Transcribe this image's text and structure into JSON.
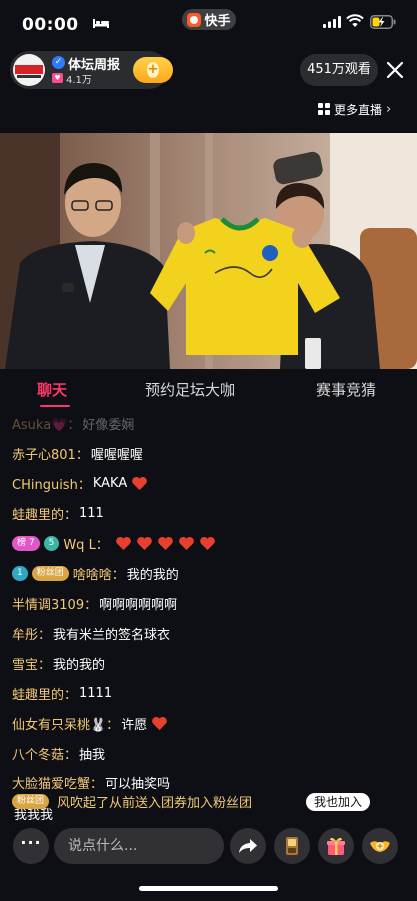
{
  "status_bar": {
    "time": "00:00",
    "app_name": "快手"
  },
  "streamer": {
    "name": "体坛周报",
    "likes": "4.1万"
  },
  "viewers": "451万观看",
  "more_live": "更多直播",
  "tabs": [
    "聊天",
    "预约足坛大咖",
    "赛事竞猜"
  ],
  "chat": [
    {
      "user": "Asuka💗：",
      "text": "好像委娴"
    },
    {
      "user": "赤子心801：",
      "text": "喔喔喔喔"
    },
    {
      "user": "CHinguish：",
      "text": "KAKA",
      "heart": 1
    },
    {
      "user": "蛙趣里的：",
      "text": "111"
    },
    {
      "badges": [
        {
          "text": "榜 7",
          "color": "pink"
        },
        {
          "text": "5",
          "color": "teal"
        }
      ],
      "user": "Wq L：",
      "text": "",
      "heart": 5
    },
    {
      "badges": [
        {
          "text": "1",
          "color": "cyan"
        },
        {
          "text": "粉丝团",
          "color": "gold"
        }
      ],
      "user": "啥啥啥：",
      "text": "我的我的"
    },
    {
      "user": "半情调3109：",
      "text": "啊啊啊啊啊啊"
    },
    {
      "user": "牟彤：",
      "text": "我有米兰的签名球衣"
    },
    {
      "user": "雪宝：",
      "text": "我的我的"
    },
    {
      "user": "蛙趣里的：",
      "text": "1111"
    },
    {
      "user": "仙女有只呆桃🐰：",
      "text": "许愿",
      "heart": 1
    },
    {
      "user": "八个冬菇：",
      "text": "抽我"
    },
    {
      "user": "大脸猫爱吃蟹：",
      "text": "可以抽奖吗"
    },
    {
      "user": "",
      "text": "我我我"
    }
  ],
  "banner": {
    "badge": "粉丝团",
    "text": "风吹起了从前送入团券加入粉丝团",
    "join_label": "我也加入"
  },
  "input": {
    "placeholder": "说点什么..."
  },
  "more_label": "···",
  "colors": {
    "accent": "#fe3666",
    "username": "#f2c876",
    "heart": "#e8402f"
  }
}
